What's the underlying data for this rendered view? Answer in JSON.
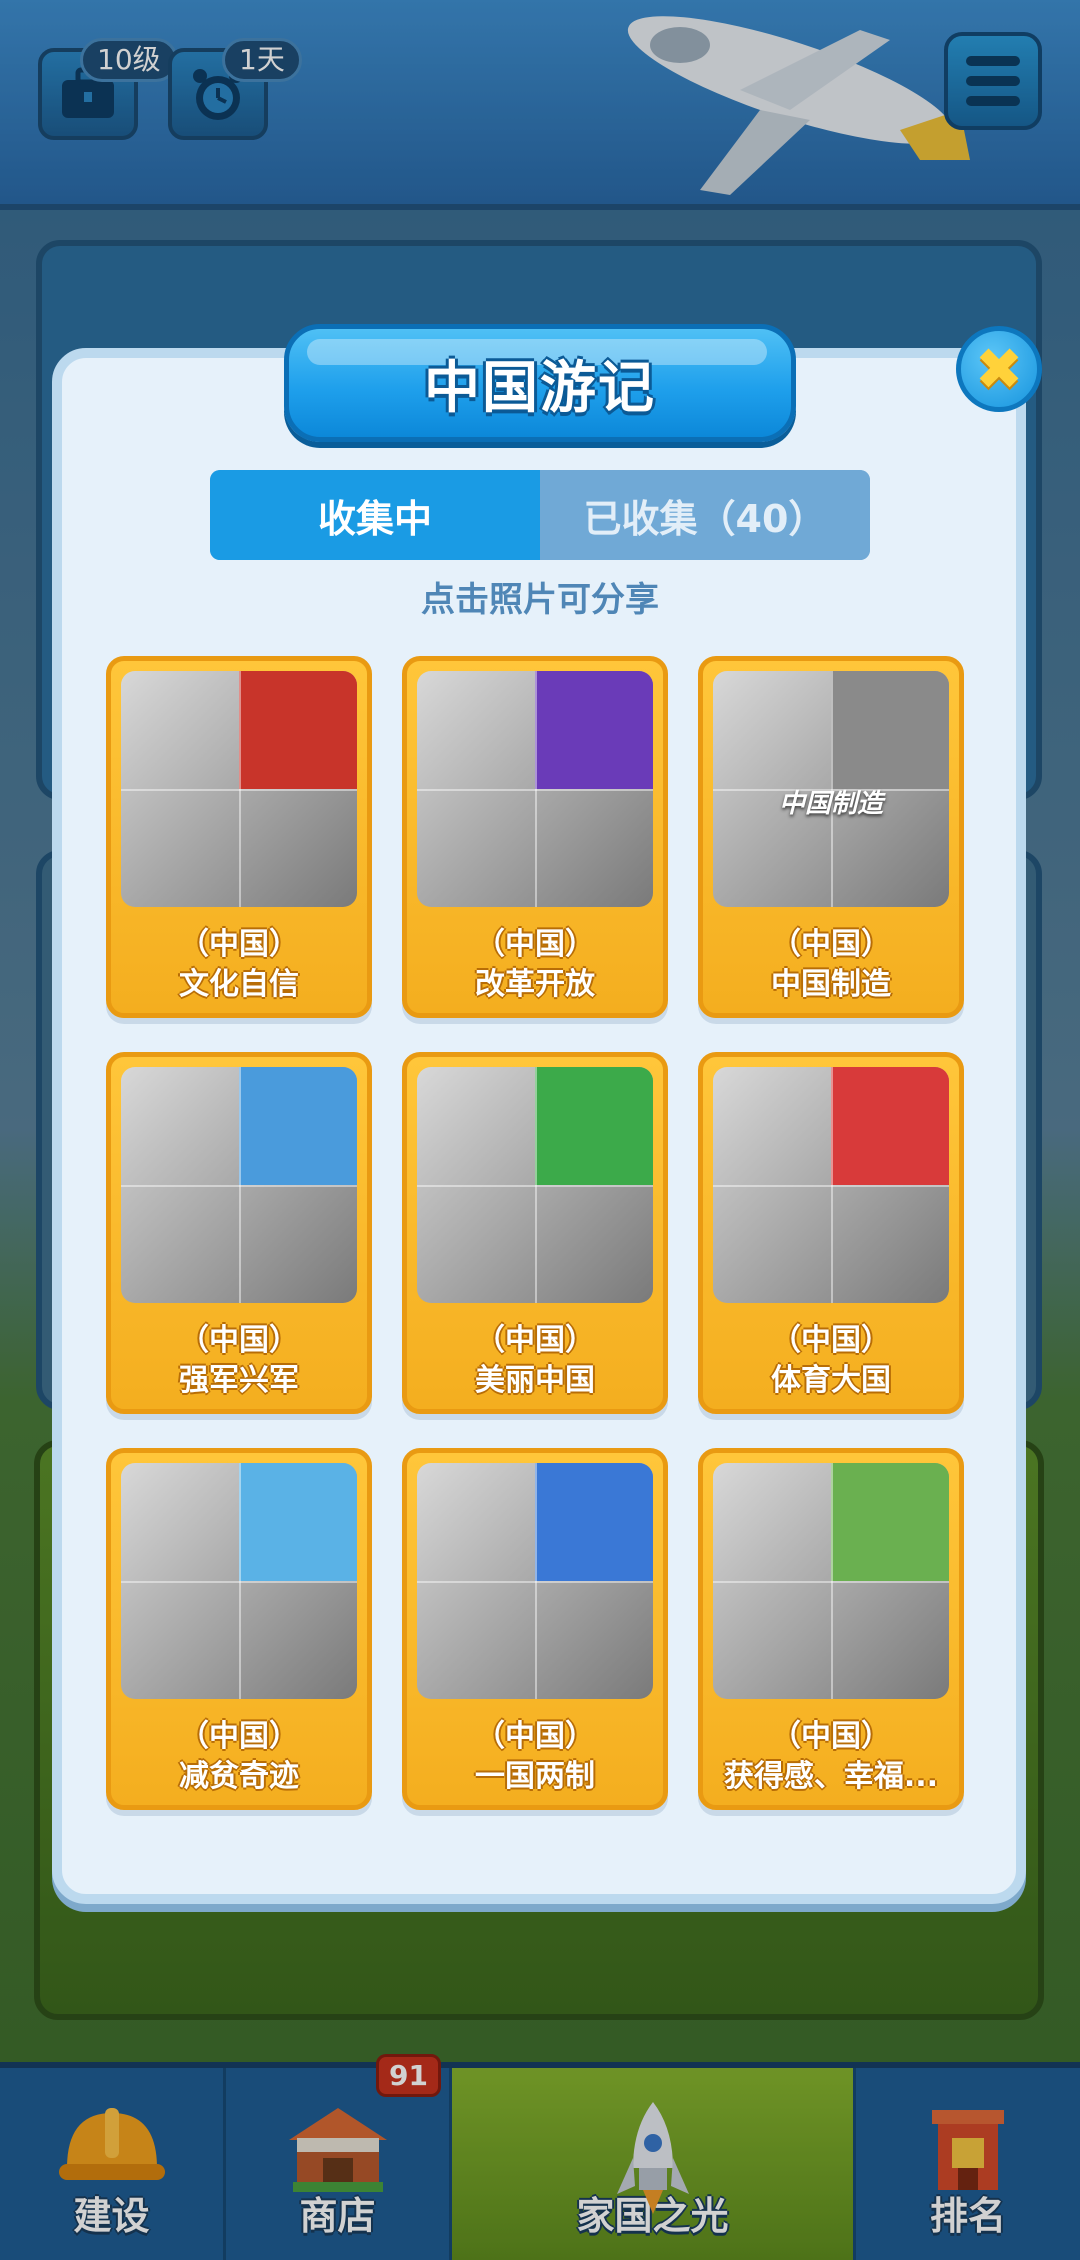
{
  "top_bar": {
    "level_badge": "10级",
    "days_badge": "1天",
    "icons": [
      "briefcase-icon",
      "alarm-clock-icon",
      "menu-icon"
    ]
  },
  "modal": {
    "title": "中国游记",
    "tabs": [
      {
        "label": "收集中",
        "active": true
      },
      {
        "label": "已收集（40）",
        "active": false
      }
    ],
    "hint": "点击照片可分享",
    "close_icon": "close-icon",
    "cards": [
      {
        "region": "（中国）",
        "name": "文化自信",
        "overlay": "",
        "accent": "#c8342a"
      },
      {
        "region": "（中国）",
        "name": "改革开放",
        "overlay": "",
        "accent": "#6a3bb8"
      },
      {
        "region": "（中国）",
        "name": "中国制造",
        "overlay": "中国制造",
        "accent": "#8a8a8a"
      },
      {
        "region": "（中国）",
        "name": "强军兴军",
        "overlay": "",
        "accent": "#4a9bdc"
      },
      {
        "region": "（中国）",
        "name": "美丽中国",
        "overlay": "",
        "accent": "#3caa4a"
      },
      {
        "region": "（中国）",
        "name": "体育大国",
        "overlay": "",
        "accent": "#d83a3a"
      },
      {
        "region": "（中国）",
        "name": "减贫奇迹",
        "overlay": "",
        "accent": "#5ab2e6"
      },
      {
        "region": "（中国）",
        "name": "一国两制",
        "overlay": "",
        "accent": "#3a78d6"
      },
      {
        "region": "（中国）",
        "name": "获得感、幸福...",
        "overlay": "",
        "accent": "#6ab050"
      }
    ]
  },
  "bottom_nav": {
    "items": [
      {
        "label": "建设",
        "icon": "hard-hat-icon",
        "active": false
      },
      {
        "label": "商店",
        "icon": "shop-icon",
        "active": false,
        "badge": "91"
      },
      {
        "label": "家国之光",
        "icon": "rocket-icon",
        "active": true
      },
      {
        "label": "排名",
        "icon": "ranking-building-icon",
        "active": false
      }
    ]
  },
  "colors": {
    "modal_bg": "#e6f1fa",
    "title_blue": "#1fa0ec",
    "card_gold": "#ffc63a",
    "tab_active": "#1a9be4",
    "tab_inactive": "#70a9d6",
    "hint_text": "#4f86b6"
  }
}
